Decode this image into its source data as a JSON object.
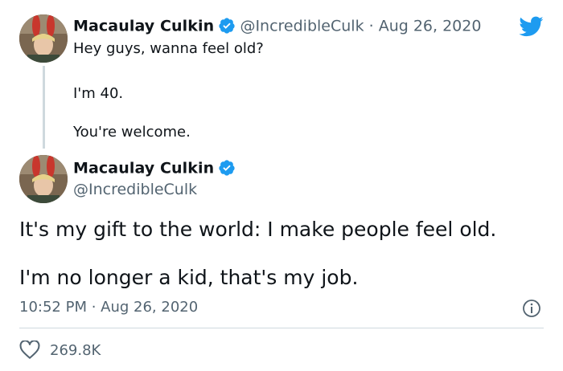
{
  "reply_tweet": {
    "author_name": "Macaulay Culkin",
    "meta": "@IncredibleCulk · Aug 26, 2020",
    "lines": [
      "Hey guys, wanna feel old?",
      "I'm 40.",
      "You're welcome."
    ]
  },
  "main_tweet": {
    "author_name": "Macaulay Culkin",
    "handle": "@IncredibleCulk",
    "lines": [
      "It's my gift to the world: I make people feel old.",
      "I'm no longer a kid, that's my job."
    ],
    "timestamp": "10:52 PM · Aug 26, 2020",
    "like_count": "269.8K"
  },
  "icons": {
    "brand": "twitter-bird-icon",
    "verified": "verified-badge-icon",
    "info": "info-icon",
    "like": "heart-icon"
  },
  "colors": {
    "twitter_blue": "#1d9bf0",
    "text_primary": "#0f1419",
    "text_secondary": "#536471",
    "divider": "#cfd9de"
  }
}
